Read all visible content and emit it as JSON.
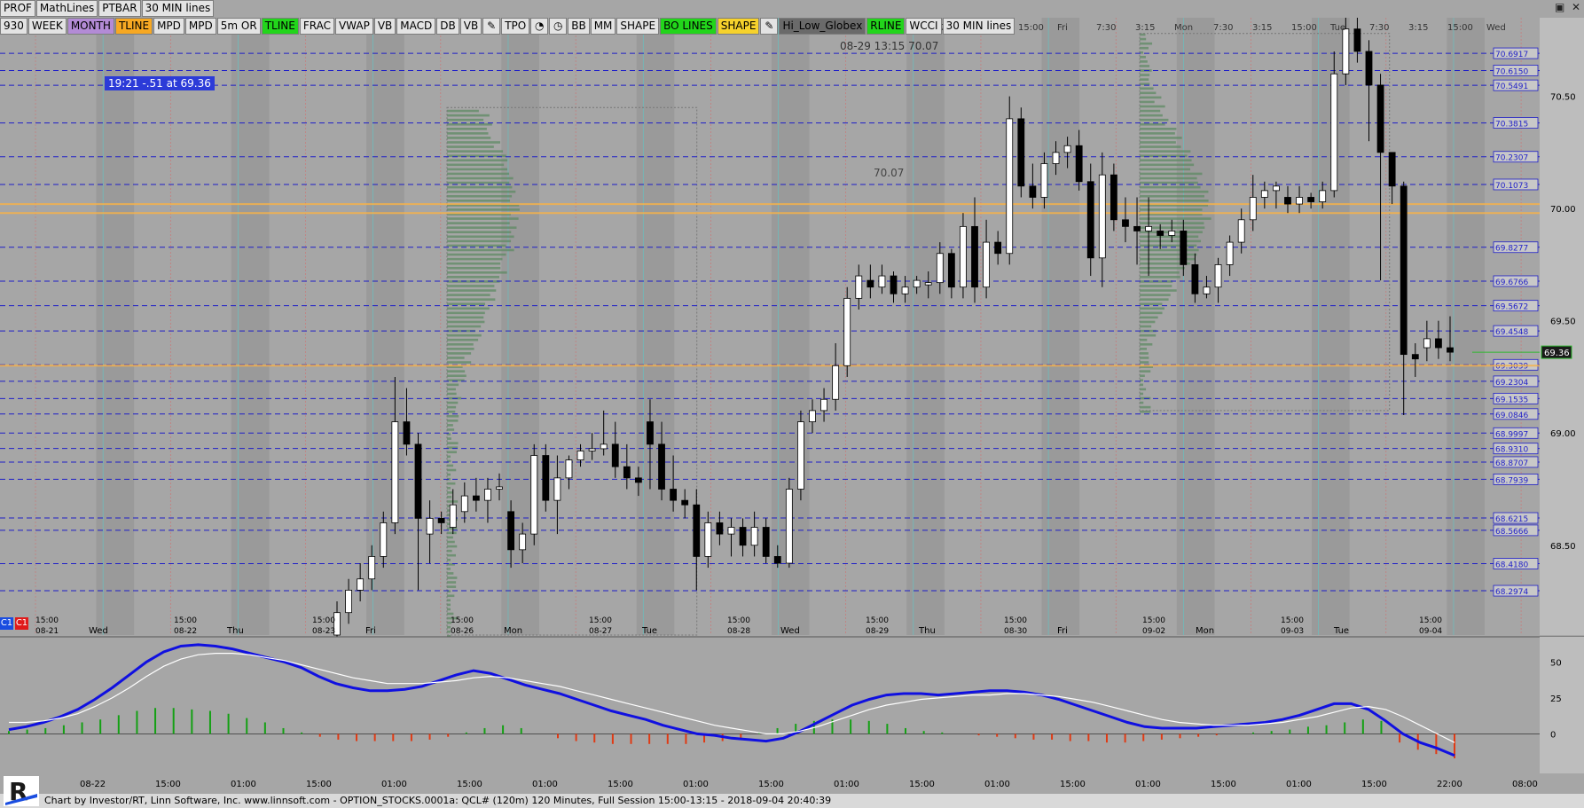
{
  "toolbar": {
    "row1": [
      "PROF",
      "MathLines",
      "PTBAR",
      "30 MIN lines"
    ],
    "row2": [
      {
        "label": "930",
        "style": "plain"
      },
      {
        "label": "WEEK",
        "style": "plain"
      },
      {
        "label": "MONTH",
        "style": "purple"
      },
      {
        "label": "TLINE",
        "style": "orange"
      },
      {
        "label": "MPD",
        "style": "plain"
      },
      {
        "label": "MPD",
        "style": "plain"
      },
      {
        "label": "5m OR",
        "style": "plain"
      },
      {
        "label": "TLINE",
        "style": "green"
      },
      {
        "label": "FRAC",
        "style": "plain"
      },
      {
        "label": "VWAP",
        "style": "plain"
      },
      {
        "label": "VB",
        "style": "plain"
      },
      {
        "label": "MACD",
        "style": "plain"
      },
      {
        "label": "DB",
        "style": "plain"
      },
      {
        "label": "VB",
        "style": "plain"
      },
      {
        "label": "pencil-icon",
        "style": "icon"
      },
      {
        "label": "TPO",
        "style": "plain"
      },
      {
        "label": "pie-icon",
        "style": "icon"
      },
      {
        "label": "clock-icon",
        "style": "icon"
      },
      {
        "label": "BB",
        "style": "plain"
      },
      {
        "label": "MM",
        "style": "plain"
      },
      {
        "label": "SHAPE",
        "style": "plain"
      },
      {
        "label": "BO LINES",
        "style": "green"
      },
      {
        "label": "SHAPE",
        "style": "yellow"
      },
      {
        "label": "pencil-icon",
        "style": "icon"
      },
      {
        "label": "Hi_Low_Globex",
        "style": "dark"
      },
      {
        "label": "RLINE",
        "style": "green"
      },
      {
        "label": "WCCI",
        "style": "plain"
      },
      {
        "label": "30 MIN lines",
        "style": "plain"
      }
    ]
  },
  "info_box": "19:21  -.51 at 69.36",
  "crosshair_label": "08-29 13:15  70.07",
  "price_tag_text": "70.07",
  "footer_text": "Chart by Investor/RT, Linn Software, Inc. www.linnsoft.com - OPTION_STOCKS.0001a: QCL# (120m) 120 Minutes, Full Session 15:00-13:15 - 2018-09-04 20:40:39",
  "colors": {
    "level_line": "#1f1fc8",
    "candle_up": "#ffffff",
    "candle_down": "#000000",
    "profile": "#5e8a63",
    "orange_line": "#f6b24a",
    "cci_main": "#1010e0",
    "cci_signal": "#ffffff",
    "hist_up": "#14a014",
    "hist_down": "#e03a14",
    "last_price": "#2eb82e"
  },
  "chart_data": [
    {
      "type": "candlestick",
      "title": "QCL# (120m)",
      "price_axis_ticks": [
        "70.50",
        "70.00",
        "69.50",
        "69.00",
        "68.50"
      ],
      "level_labels": [
        "70.6917",
        "70.6150",
        "70.5491",
        "70.3815",
        "70.2307",
        "70.1073",
        "69.8277",
        "69.6766",
        "69.5672",
        "69.4548",
        "69.3039",
        "69.2304",
        "69.1535",
        "69.0846",
        "68.9997",
        "68.9310",
        "68.8707",
        "68.7939",
        "68.6215",
        "68.5666",
        "68.4180",
        "68.2974"
      ],
      "last_price": "69.36",
      "ylim": [
        68.1,
        70.85
      ],
      "top_axis_labels": [
        "7:30",
        "3:15",
        "15:00",
        "Fri",
        "7:30",
        "3:15",
        "Mon",
        "7:30",
        "3:15",
        "15:00",
        "Tue",
        "7:30",
        "3:15",
        "15:00",
        "Wed"
      ],
      "bottom_axis_labels": [
        {
          "time": "15:00",
          "date": "08-21",
          "day": "Wed"
        },
        {
          "time": "15:00",
          "date": "08-22",
          "day": "Thu"
        },
        {
          "time": "15:00",
          "date": "08-23",
          "day": "Fri"
        },
        {
          "time": "15:00",
          "date": "08-26",
          "day": "Mon"
        },
        {
          "time": "15:00",
          "date": "08-27",
          "day": "Tue"
        },
        {
          "time": "15:00",
          "date": "08-28",
          "day": "Wed"
        },
        {
          "time": "15:00",
          "date": "08-29",
          "day": "Thu"
        },
        {
          "time": "15:00",
          "date": "08-30",
          "day": "Fri"
        },
        {
          "time": "15:00",
          "date": "09-02",
          "day": "Mon"
        },
        {
          "time": "15:00",
          "date": "09-03",
          "day": "Tue"
        },
        {
          "time": "15:00",
          "date": "09-04",
          "day": ""
        }
      ],
      "candles": [
        [
          68.1,
          68.2,
          68.05,
          68.25
        ],
        [
          68.2,
          68.3,
          68.15,
          68.35
        ],
        [
          68.3,
          68.35,
          68.25,
          68.42
        ],
        [
          68.35,
          68.45,
          68.3,
          68.5
        ],
        [
          68.45,
          68.6,
          68.4,
          68.65
        ],
        [
          68.6,
          69.05,
          68.55,
          69.25
        ],
        [
          69.05,
          68.95,
          68.9,
          69.2
        ],
        [
          68.95,
          68.62,
          68.3,
          69.0
        ],
        [
          68.55,
          68.62,
          68.42,
          68.7
        ],
        [
          68.62,
          68.6,
          68.55,
          68.65
        ],
        [
          68.58,
          68.68,
          68.55,
          68.75
        ],
        [
          68.65,
          68.72,
          68.6,
          68.78
        ],
        [
          68.72,
          68.7,
          68.65,
          68.8
        ],
        [
          68.7,
          68.75,
          68.6,
          68.8
        ],
        [
          68.75,
          68.76,
          68.7,
          68.82
        ],
        [
          68.65,
          68.48,
          68.4,
          68.7
        ],
        [
          68.48,
          68.55,
          68.42,
          68.6
        ],
        [
          68.55,
          68.9,
          68.5,
          68.95
        ],
        [
          68.9,
          68.7,
          68.65,
          68.95
        ],
        [
          68.7,
          68.8,
          68.55,
          68.9
        ],
        [
          68.8,
          68.88,
          68.75,
          68.9
        ],
        [
          68.88,
          68.92,
          68.85,
          68.95
        ],
        [
          68.92,
          68.93,
          68.88,
          69.0
        ],
        [
          68.93,
          68.95,
          68.9,
          69.1
        ],
        [
          68.95,
          68.85,
          68.8,
          69.05
        ],
        [
          68.85,
          68.8,
          68.75,
          68.95
        ],
        [
          68.8,
          68.78,
          68.72,
          68.85
        ],
        [
          69.05,
          68.95,
          68.75,
          69.15
        ],
        [
          68.95,
          68.75,
          68.7,
          69.05
        ],
        [
          68.75,
          68.7,
          68.65,
          68.9
        ],
        [
          68.7,
          68.68,
          68.62,
          68.75
        ],
        [
          68.68,
          68.45,
          68.3,
          68.75
        ],
        [
          68.45,
          68.6,
          68.4,
          68.65
        ],
        [
          68.6,
          68.55,
          68.5,
          68.65
        ],
        [
          68.55,
          68.58,
          68.45,
          68.62
        ],
        [
          68.58,
          68.5,
          68.45,
          68.62
        ],
        [
          68.5,
          68.58,
          68.45,
          68.65
        ],
        [
          68.58,
          68.45,
          68.42,
          68.62
        ],
        [
          68.45,
          68.42,
          68.4,
          68.5
        ],
        [
          68.42,
          68.75,
          68.4,
          68.8
        ],
        [
          68.75,
          69.05,
          68.7,
          69.1
        ],
        [
          69.05,
          69.1,
          69.0,
          69.15
        ],
        [
          69.1,
          69.15,
          69.05,
          69.2
        ],
        [
          69.15,
          69.3,
          69.1,
          69.4
        ],
        [
          69.3,
          69.6,
          69.25,
          69.65
        ],
        [
          69.6,
          69.7,
          69.55,
          69.75
        ],
        [
          69.68,
          69.65,
          69.6,
          69.75
        ],
        [
          69.65,
          69.7,
          69.62,
          69.75
        ],
        [
          69.7,
          69.62,
          69.58,
          69.72
        ],
        [
          69.62,
          69.65,
          69.58,
          69.7
        ],
        [
          69.65,
          69.68,
          69.62,
          69.7
        ],
        [
          69.66,
          69.67,
          69.6,
          69.72
        ],
        [
          69.67,
          69.8,
          69.62,
          69.85
        ],
        [
          69.8,
          69.65,
          69.6,
          69.82
        ],
        [
          69.65,
          69.92,
          69.6,
          69.98
        ],
        [
          69.92,
          69.65,
          69.58,
          70.05
        ],
        [
          69.65,
          69.85,
          69.6,
          69.95
        ],
        [
          69.85,
          69.8,
          69.75,
          69.9
        ],
        [
          69.8,
          70.4,
          69.75,
          70.5
        ],
        [
          70.4,
          70.1,
          70.05,
          70.45
        ],
        [
          70.1,
          70.05,
          70.0,
          70.2
        ],
        [
          70.05,
          70.2,
          70.0,
          70.25
        ],
        [
          70.2,
          70.25,
          70.15,
          70.3
        ],
        [
          70.25,
          70.28,
          70.18,
          70.32
        ],
        [
          70.28,
          70.12,
          70.08,
          70.35
        ],
        [
          70.12,
          69.78,
          69.7,
          70.2
        ],
        [
          69.78,
          70.15,
          69.65,
          70.25
        ],
        [
          70.15,
          69.95,
          69.9,
          70.2
        ],
        [
          69.95,
          69.92,
          69.85,
          70.05
        ],
        [
          69.92,
          69.9,
          69.75,
          70.05
        ],
        [
          69.9,
          69.92,
          69.7,
          70.05
        ],
        [
          69.9,
          69.88,
          69.82,
          69.93
        ],
        [
          69.88,
          69.9,
          69.85,
          69.95
        ],
        [
          69.9,
          69.75,
          69.7,
          69.95
        ],
        [
          69.75,
          69.62,
          69.58,
          69.8
        ],
        [
          69.62,
          69.65,
          69.6,
          69.7
        ],
        [
          69.65,
          69.75,
          69.58,
          69.78
        ],
        [
          69.75,
          69.85,
          69.7,
          69.88
        ],
        [
          69.85,
          69.95,
          69.8,
          70.0
        ],
        [
          69.95,
          70.05,
          69.9,
          70.15
        ],
        [
          70.05,
          70.08,
          70.0,
          70.12
        ],
        [
          70.08,
          70.1,
          70.0,
          70.12
        ],
        [
          70.05,
          70.02,
          69.98,
          70.1
        ],
        [
          70.02,
          70.05,
          69.98,
          70.1
        ],
        [
          70.05,
          70.03,
          70.0,
          70.07
        ],
        [
          70.03,
          70.08,
          70.0,
          70.12
        ],
        [
          70.08,
          70.6,
          70.05,
          70.7
        ],
        [
          70.6,
          70.8,
          70.55,
          70.85
        ],
        [
          70.8,
          70.7,
          70.65,
          70.85
        ],
        [
          70.7,
          70.55,
          70.3,
          70.75
        ],
        [
          70.55,
          70.25,
          69.68,
          70.6
        ],
        [
          70.25,
          70.1,
          70.02,
          70.25
        ],
        [
          70.1,
          69.35,
          69.08,
          70.12
        ],
        [
          69.35,
          69.33,
          69.25,
          69.4
        ],
        [
          69.38,
          69.42,
          69.32,
          69.5
        ],
        [
          69.42,
          69.38,
          69.33,
          69.5
        ],
        [
          69.38,
          69.36,
          69.32,
          69.52
        ]
      ],
      "volume_profiles": [
        {
          "session": "08-26",
          "poc": 69.98,
          "value_low": 68.1,
          "value_high": 70.45
        },
        {
          "session": "09-02",
          "poc": 70.0,
          "value_low": 69.1,
          "value_high": 70.78
        }
      ],
      "orange_lines": [
        69.98,
        70.02,
        69.3
      ]
    },
    {
      "type": "line",
      "title": "WCCI",
      "ylim": [
        -25,
        65
      ],
      "y_ticks": [
        "50",
        "25",
        "0"
      ],
      "x_tick_labels": [
        "08-22",
        "15:00",
        "01:00",
        "15:00",
        "01:00",
        "15:00",
        "01:00",
        "15:00",
        "01:00",
        "15:00",
        "01:00",
        "15:00",
        "01:00",
        "15:00",
        "01:00",
        "15:00",
        "01:00",
        "15:00",
        "22:00",
        "08:00"
      ],
      "series": [
        {
          "key": "cci",
          "values": [
            3,
            5,
            8,
            12,
            17,
            24,
            32,
            41,
            50,
            57,
            61,
            62,
            61,
            59,
            56,
            53,
            50,
            46,
            40,
            35,
            32,
            30,
            30,
            31,
            33,
            37,
            41,
            44,
            42,
            38,
            34,
            31,
            28,
            24,
            20,
            16,
            13,
            10,
            6,
            3,
            0,
            -1,
            -3,
            -4,
            -5,
            -3,
            2,
            8,
            14,
            20,
            24,
            27,
            28,
            28,
            27,
            28,
            29,
            30,
            30,
            29,
            27,
            24,
            20,
            16,
            12,
            8,
            5,
            4,
            4,
            4,
            5,
            6,
            7,
            8,
            10,
            13,
            17,
            21,
            21,
            17,
            9,
            0,
            -6,
            -10,
            -15
          ]
        },
        {
          "key": "signal",
          "values": [
            8,
            8,
            9,
            11,
            14,
            19,
            25,
            32,
            40,
            47,
            52,
            55,
            56,
            56,
            55,
            53,
            51,
            48,
            45,
            42,
            39,
            37,
            35,
            35,
            35,
            36,
            37,
            39,
            40,
            39,
            37,
            35,
            33,
            30,
            27,
            24,
            21,
            18,
            15,
            12,
            9,
            6,
            4,
            2,
            0,
            0,
            2,
            5,
            9,
            13,
            17,
            20,
            22,
            24,
            25,
            26,
            27,
            27,
            28,
            28,
            27,
            26,
            24,
            22,
            19,
            16,
            13,
            10,
            8,
            7,
            6,
            6,
            6,
            7,
            8,
            10,
            12,
            15,
            18,
            19,
            17,
            12,
            6,
            0,
            -6
          ]
        }
      ],
      "histogram": [
        2,
        3,
        4,
        6,
        8,
        10,
        13,
        16,
        18,
        18,
        17,
        16,
        14,
        11,
        8,
        4,
        1,
        -2,
        -4,
        -5,
        -5,
        -5,
        -5,
        -4,
        -2,
        1,
        4,
        6,
        4,
        0,
        -3,
        -5,
        -6,
        -7,
        -7,
        -7,
        -7,
        -7,
        -6,
        -5,
        -3,
        1,
        4,
        7,
        9,
        10,
        10,
        9,
        7,
        4,
        2,
        1,
        0,
        -1,
        -2,
        -3,
        -4,
        -4,
        -5,
        -5,
        -6,
        -6,
        -5,
        -4,
        -3,
        -2,
        -1,
        0,
        1,
        2,
        3,
        5,
        6,
        8,
        10,
        9,
        -6,
        -11,
        -14,
        -17
      ]
    }
  ]
}
